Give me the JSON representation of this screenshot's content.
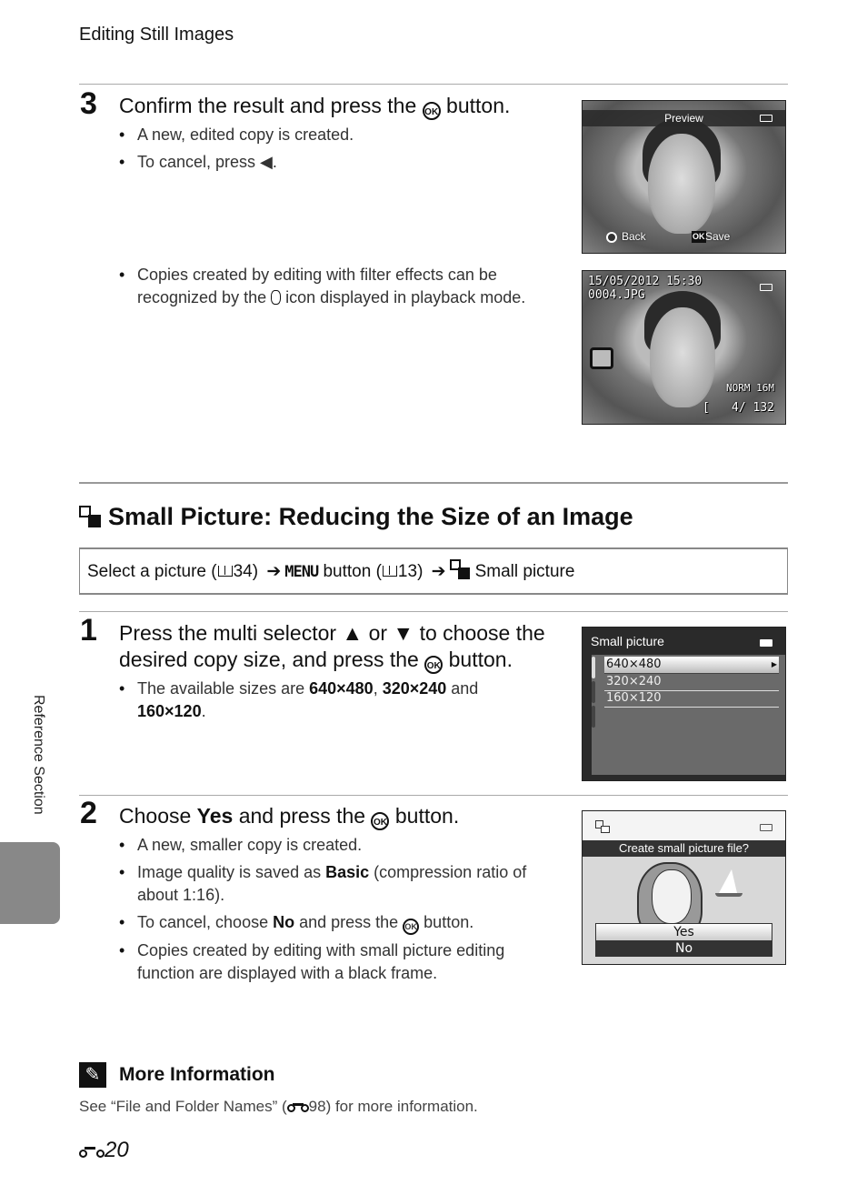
{
  "header": {
    "chapter": "Editing Still Images"
  },
  "step3": {
    "number": "3",
    "title_before": "Confirm the result and press the ",
    "ok_glyph": "OK",
    "title_after": " button.",
    "bullets": [
      "A new, edited copy is created.",
      "To cancel, press ◀."
    ],
    "bullet3_before": "Copies created by editing with filter effects can be recognized by the ",
    "bullet3_after": " icon displayed in playback mode.",
    "preview_screen": {
      "title": "Preview",
      "back_label": "Back",
      "save_key": "OK",
      "save_label": "Save"
    },
    "playback_screen": {
      "datetime": "15/05/2012 15:30",
      "filename": "0004.JPG",
      "quality": "NORM",
      "size_code": "16M",
      "counter": "4/ 132"
    }
  },
  "section": {
    "title": "Small Picture: Reducing the Size of an Image",
    "nav": {
      "part1": "Select a picture (",
      "ref1": "34",
      "part2": ") ",
      "menu_word": "MENU",
      "part3": " button (",
      "ref2": "13",
      "part4": ") ",
      "final": "Small picture"
    }
  },
  "step1": {
    "number": "1",
    "title_l1_a": "Press the multi selector ",
    "up": "▲",
    "title_l1_b": " or ",
    "down": "▼",
    "title_l1_c": " to choose the",
    "title_l2_a": "desired copy size, and press the ",
    "ok_glyph": "OK",
    "title_l2_b": " button.",
    "bullet_a": "The available sizes are ",
    "size1": "640×480",
    "sep": ", ",
    "size2": "320×240",
    "and": " and",
    "size3": "160×120",
    "end": ".",
    "menu_screen": {
      "title": "Small picture",
      "options": [
        "640×480",
        "320×240",
        "160×120"
      ],
      "selected": "640×480"
    }
  },
  "step2": {
    "number": "2",
    "title_a": "Choose ",
    "title_bold": "Yes",
    "title_b": " and press the ",
    "ok_glyph": "OK",
    "title_c": " button.",
    "b1": "A new, smaller copy is created.",
    "b2_a": "Image quality is saved as ",
    "b2_bold": "Basic",
    "b2_b": " (compression ratio of about 1:16).",
    "b3_a": "To cancel, choose ",
    "b3_bold": "No",
    "b3_b": " and press the ",
    "b3_c": " button.",
    "b4": "Copies created by editing with small picture editing function are displayed with a black frame.",
    "dialog_screen": {
      "prompt": "Create small picture file?",
      "yes": "Yes",
      "no": "No",
      "selected": "Yes"
    }
  },
  "side": {
    "label": "Reference Section"
  },
  "note": {
    "title": "More Information",
    "text_a": "See “File and Folder Names” (",
    "ref": "98",
    "text_b": ") for more information."
  },
  "footer": {
    "page": "20"
  }
}
